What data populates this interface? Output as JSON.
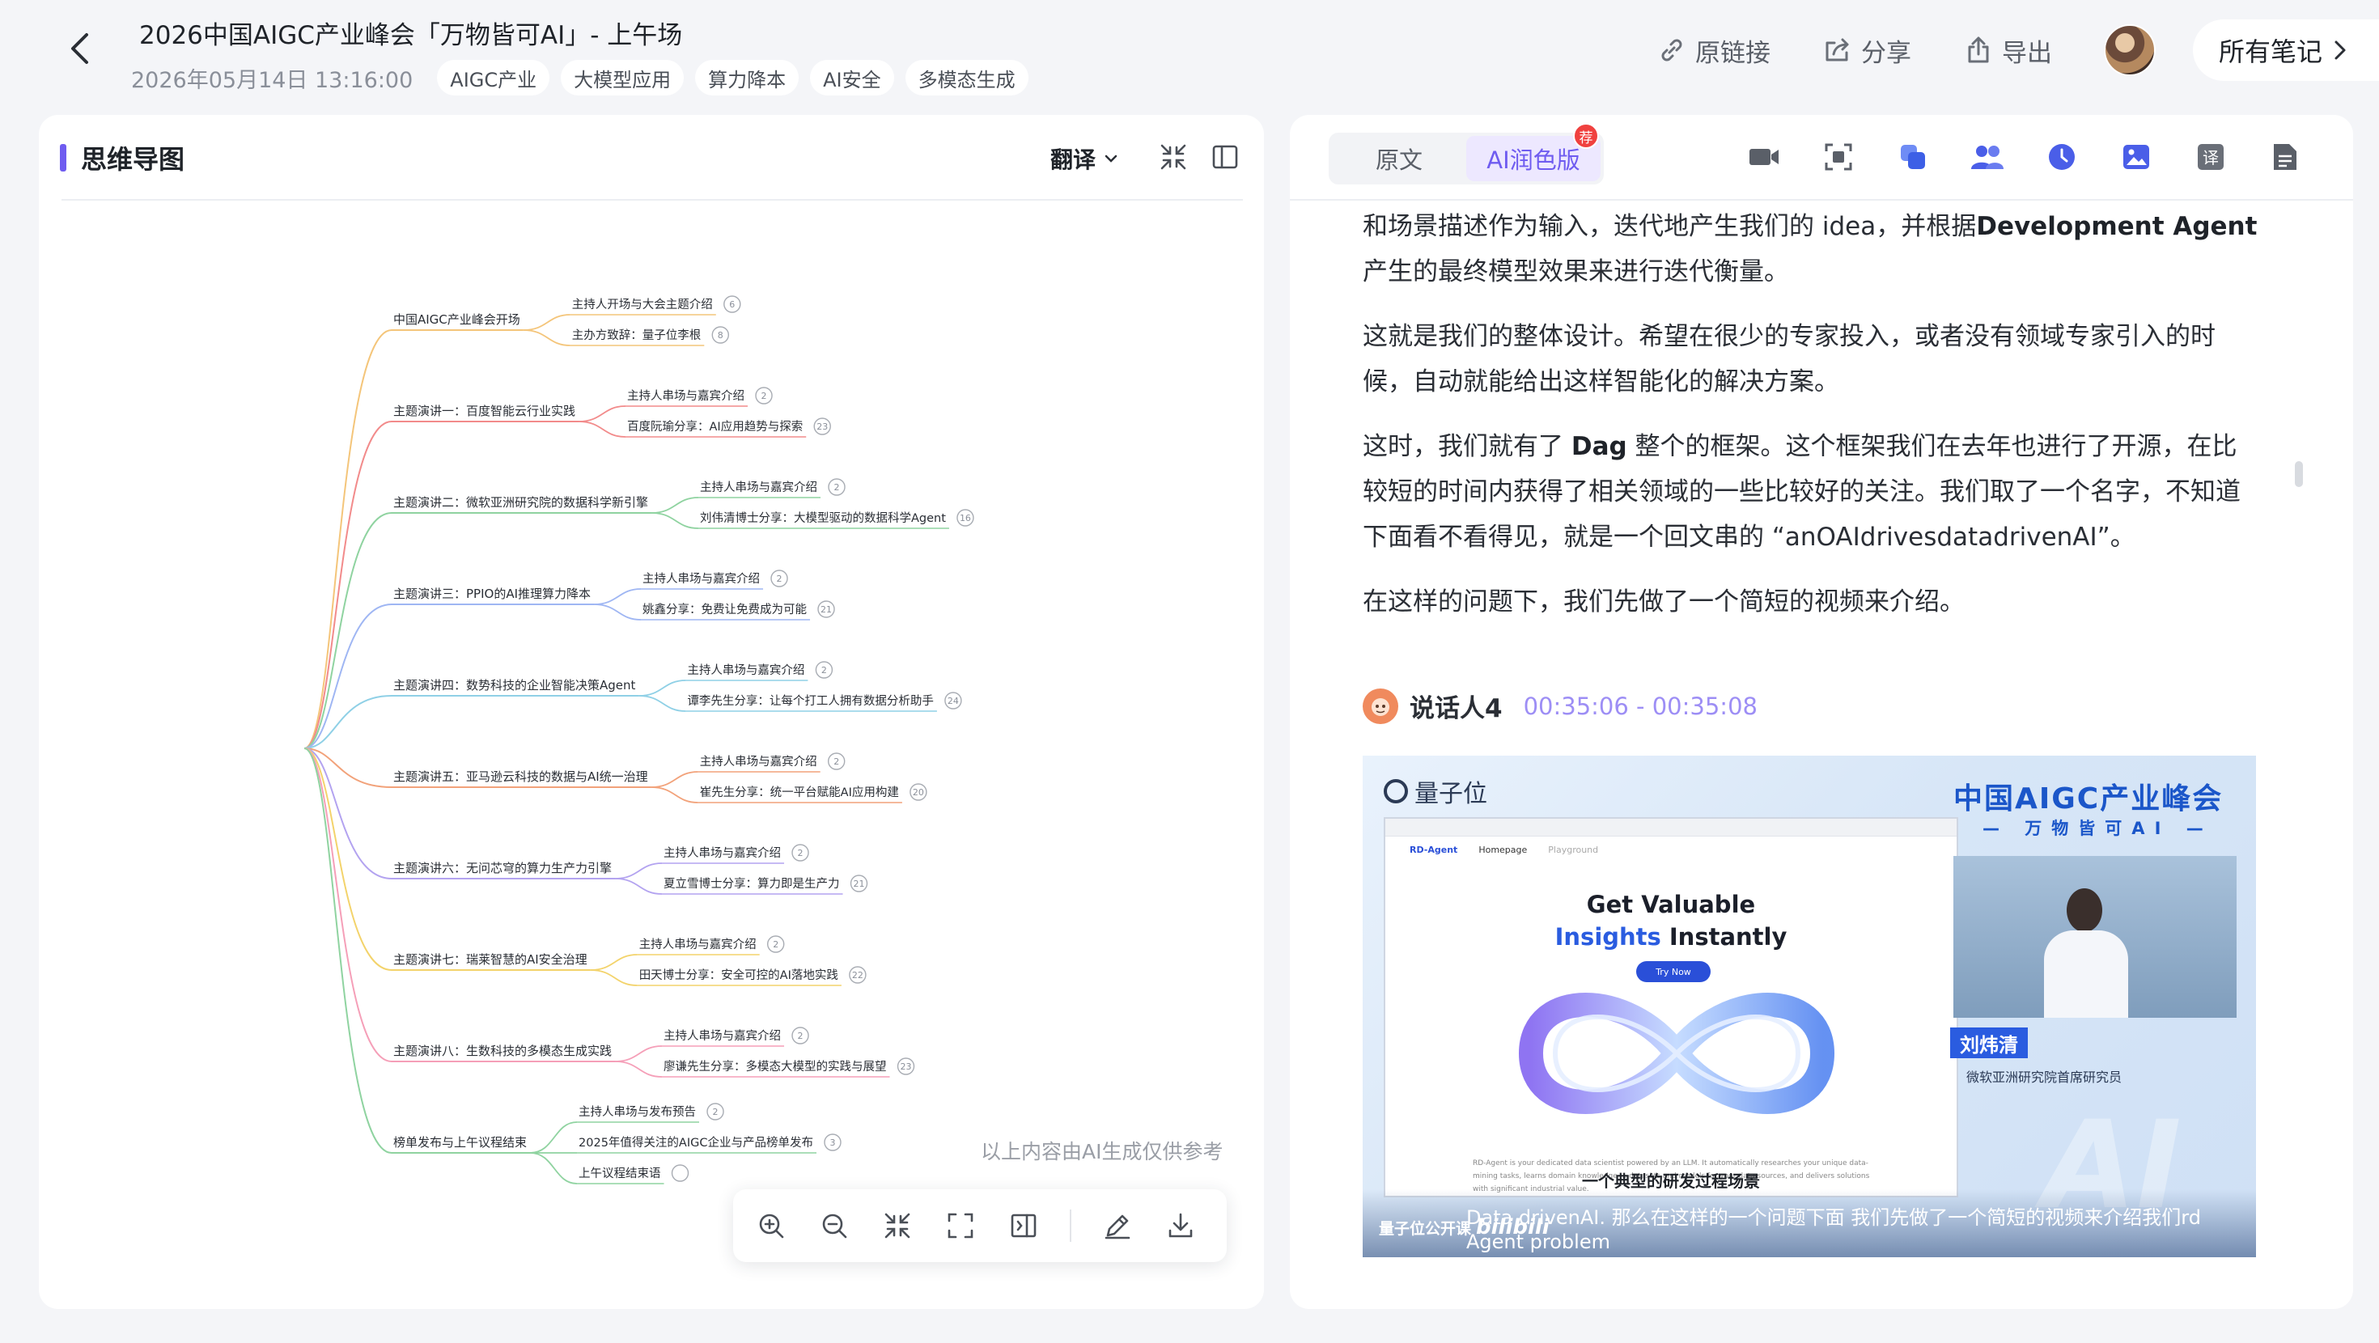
{
  "header": {
    "title": "2026中国AIGC产业峰会「万物皆可AI」- 上午场",
    "date": "2026年05月14日 13:16:00",
    "tags": [
      "AIGC产业",
      "大模型应用",
      "算力降本",
      "AI安全",
      "多模态生成"
    ],
    "actions": {
      "original_link": "原链接",
      "share": "分享",
      "export": "导出"
    },
    "all_notes": "所有笔记"
  },
  "mindmap_panel": {
    "title": "思维导图",
    "translate": "翻译",
    "ai_note": "以上内容由AI生成仅供参考",
    "branches": [
      {
        "label": "中国AIGC产业峰会开场",
        "children": [
          {
            "label": "主持人开场与大会主题介绍",
            "n": "6"
          },
          {
            "label": "主办方致辞：量子位李根",
            "n": "8"
          }
        ]
      },
      {
        "label": "主题演讲一：百度智能云行业实践",
        "children": [
          {
            "label": "主持人串场与嘉宾介绍",
            "n": "2"
          },
          {
            "label": "百度阮瑜分享：AI应用趋势与探索",
            "n": "23"
          }
        ]
      },
      {
        "label": "主题演讲二：微软亚洲研究院的数据科学新引擎",
        "children": [
          {
            "label": "主持人串场与嘉宾介绍",
            "n": "2"
          },
          {
            "label": "刘伟清博士分享：大模型驱动的数据科学Agent",
            "n": "16"
          }
        ]
      },
      {
        "label": "主题演讲三：PPIO的AI推理算力降本",
        "children": [
          {
            "label": "主持人串场与嘉宾介绍",
            "n": "2"
          },
          {
            "label": "姚鑫分享：免费让免费成为可能",
            "n": "21"
          }
        ]
      },
      {
        "label": "主题演讲四：数势科技的企业智能决策Agent",
        "children": [
          {
            "label": "主持人串场与嘉宾介绍",
            "n": "2"
          },
          {
            "label": "谭李先生分享：让每个打工人拥有数据分析助手",
            "n": "24"
          }
        ]
      },
      {
        "label": "主题演讲五：亚马逊云科技的数据与AI统一治理",
        "children": [
          {
            "label": "主持人串场与嘉宾介绍",
            "n": "2"
          },
          {
            "label": "崔先生分享：统一平台赋能AI应用构建",
            "n": "20"
          }
        ]
      },
      {
        "label": "主题演讲六：无问芯穹的算力生产力引擎",
        "children": [
          {
            "label": "主持人串场与嘉宾介绍",
            "n": "2"
          },
          {
            "label": "夏立雪博士分享：算力即是生产力",
            "n": "21"
          }
        ]
      },
      {
        "label": "主题演讲七：瑞莱智慧的AI安全治理",
        "children": [
          {
            "label": "主持人串场与嘉宾介绍",
            "n": "2"
          },
          {
            "label": "田天博士分享：安全可控的AI落地实践",
            "n": "22"
          }
        ]
      },
      {
        "label": "主题演讲八：生数科技的多模态生成实践",
        "children": [
          {
            "label": "主持人串场与嘉宾介绍",
            "n": "2"
          },
          {
            "label": "廖谦先生分享：多模态大模型的实践与展望",
            "n": "23"
          }
        ]
      },
      {
        "label": "榜单发布与上午议程结束",
        "children": [
          {
            "label": "主持人串场与发布预告",
            "n": "2"
          },
          {
            "label": "2025年值得关注的AIGC企业与产品榜单发布",
            "n": "3"
          },
          {
            "label": "上午议程结束语",
            "n": ""
          }
        ]
      }
    ]
  },
  "transcript_panel": {
    "tabs": [
      "原文",
      "AI润色版"
    ],
    "active_tab": "AI润色版",
    "badge": "荐",
    "paragraphs": [
      {
        "before": "和场景描述作为输入，迭代地产生我们的 idea，并根据",
        "bold": "Development Agent",
        "after": "产生的最终模型效果来进行迭代衡量。"
      },
      {
        "before": "这就是我们的整体设计。希望在很少的专家投入，或者没有领域专家引入的时候，自动就能给出这样智能化的解决方案。",
        "bold": "",
        "after": ""
      },
      {
        "before": "这时，我们就有了 ",
        "bold": "Dag",
        "after": " 整个的框架。这个框架我们在去年也进行了开源，在比较短的时间内获得了相关领域的一些比较好的关注。我们取了一个名字，不知道下面看不看得见，就是一个回文串的 “anOAIdrivesdatadrivenAI”。"
      },
      {
        "before": "在这样的问题下，我们先做了一个简短的视频来介绍。",
        "bold": "",
        "after": ""
      }
    ],
    "speaker": {
      "name": "说话人4",
      "time": "00:35:06 - 00:35:08"
    },
    "video": {
      "brand": "量子位",
      "event_title": "中国AIGC产业峰会",
      "event_sub": "— 万物皆可AI —",
      "screen_logo": "RD-Agent",
      "screen_nav": [
        "Homepage",
        "Playground"
      ],
      "headline_1": "Get Valuable",
      "headline_2a": "Insights",
      "headline_2b": " Instantly",
      "try_now": "Try Now",
      "small_text": "RD-Agent is your dedicated data scientist powered by an LLM. It automatically researches your unique data-mining tasks, learns domain knowledge ... datasets and models for your data sources, and delivers solutions with significant industrial value.",
      "inner_caption": "一个典型的研发过程场景",
      "speaker_name": "刘炜清",
      "speaker_role": "微软亚洲研究院首席研究员",
      "bg_text": "AI",
      "subtitle": "Data drivenAI. 那么在这样的一个问题下面 我们先做了一个简短的视频来介绍我们rd Agent problem",
      "watermark": "量子位公开课",
      "watermark_site": "bilibili"
    }
  },
  "colors": {
    "accent": "#6f5cf0",
    "page_bg": "#f4f5f8",
    "badge": "#f0413f",
    "timestamp": "#9d8ef5"
  }
}
